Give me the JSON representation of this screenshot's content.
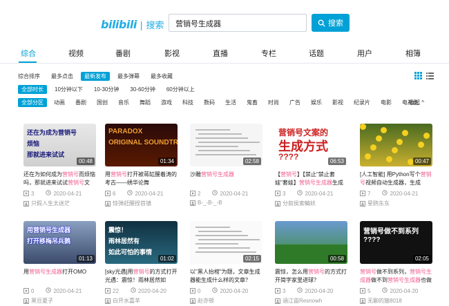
{
  "logo": {
    "mark": "bilibili",
    "sep": "|",
    "text": "搜索"
  },
  "search": {
    "value": "营销号生成器",
    "button": "搜索"
  },
  "tabs": [
    "综合",
    "视频",
    "番剧",
    "影视",
    "直播",
    "专栏",
    "话题",
    "用户",
    "相簿"
  ],
  "sort": [
    "综合排序",
    "最多点击",
    "最新发布",
    "最多弹幕",
    "最多收藏"
  ],
  "duration": [
    "全部时长",
    "10分钟以下",
    "10-30分钟",
    "30-60分钟",
    "60分钟以上"
  ],
  "zones": [
    "全部分区",
    "动画",
    "番剧",
    "国创",
    "音乐",
    "舞蹈",
    "游戏",
    "科技",
    "数码",
    "生活",
    "鬼畜",
    "时尚",
    "广告",
    "娱乐",
    "影视",
    "纪录片",
    "电影",
    "电视剧"
  ],
  "fold_label": "收起",
  "accent": "#00a1d6",
  "highlight": "#f25d8e",
  "videos": [
    {
      "dur": "00:48",
      "t1": "还在为",
      "t1h": "",
      "t2": "还在为如何成为营销号而烦恼吗，那就进来试试营销号文",
      "views": "3",
      "date": "2020-04-21",
      "up": "只假人生太迷茫",
      "thumb_lines": [
        "还在为成为营销号",
        "烦恼",
        "那就进来试试"
      ]
    },
    {
      "dur": "01:34",
      "t2": "用营销号打开被蒋缸醒着涛的考古——绣华论舞",
      "views": "6",
      "date": "2020-04-21",
      "up": "惊弹赶醒捏首镇",
      "thumb_lines": [
        "PARADOX",
        "ORIGINAL SOUNDTRACK"
      ]
    },
    {
      "dur": "02:58",
      "t2": "沙雕营销号生成器",
      "views": "2",
      "date": "2020-04-21",
      "up": "B-_-B-_-B",
      "thumb_lines": []
    },
    {
      "dur": "06:53",
      "t2": "【营销号】【禁止\"禁止套娃\"套娃】营销号生成器生成",
      "views": "3",
      "date": "2020-04-21",
      "up": "分叙侯索鳊妖",
      "thumb_lines": [
        "营销号文案的",
        "生成方式",
        "????"
      ]
    },
    {
      "dur": "00:47",
      "t2": "[人工智能] 用Python写个营销号视频自动生成器，生成",
      "views": "7",
      "date": "2020-04-21",
      "up": "星鸥东东",
      "thumb_lines": []
    },
    {
      "dur": "01:13",
      "t2": "用营销号生成器打开OMO",
      "views": "0",
      "date": "2020-04-21",
      "up": "黑豆夏子",
      "thumb_lines": [
        "用营销号生成器",
        "打开移梅吊兵鹅"
      ]
    },
    {
      "dur": "01:02",
      "t2": "[sky光遇]用营销号的方式打开光遇：震惊！雨林居然如",
      "views": "22",
      "date": "2020-04-20",
      "up": "白开水嘉羊",
      "thumb_lines": [
        "震惊！",
        "雨林居然有",
        "如此可怕的事情"
      ]
    },
    {
      "dur": "02:15",
      "t2": "以\"黑人抬棺\"为题，文章生成器能生成什么样的文章？",
      "views": "0",
      "date": "2020-04-20",
      "up": "赵亦顿",
      "thumb_lines": []
    },
    {
      "dur": "00:58",
      "t2": "震惊，怎么用营销号的方式打开简字家里进球？",
      "views": "3",
      "date": "2020-04-20",
      "up": "涵江亩Resnowh",
      "thumb_lines": []
    },
    {
      "dur": "02:05",
      "t2": "营销号做不到系列，营销号生成器做不到营销号生成器也做不到系列",
      "views": "5",
      "date": "2020-04-20",
      "up": "无聊的猿8018",
      "thumb_lines": [
        "营销号做不到系列",
        "????"
      ]
    }
  ]
}
